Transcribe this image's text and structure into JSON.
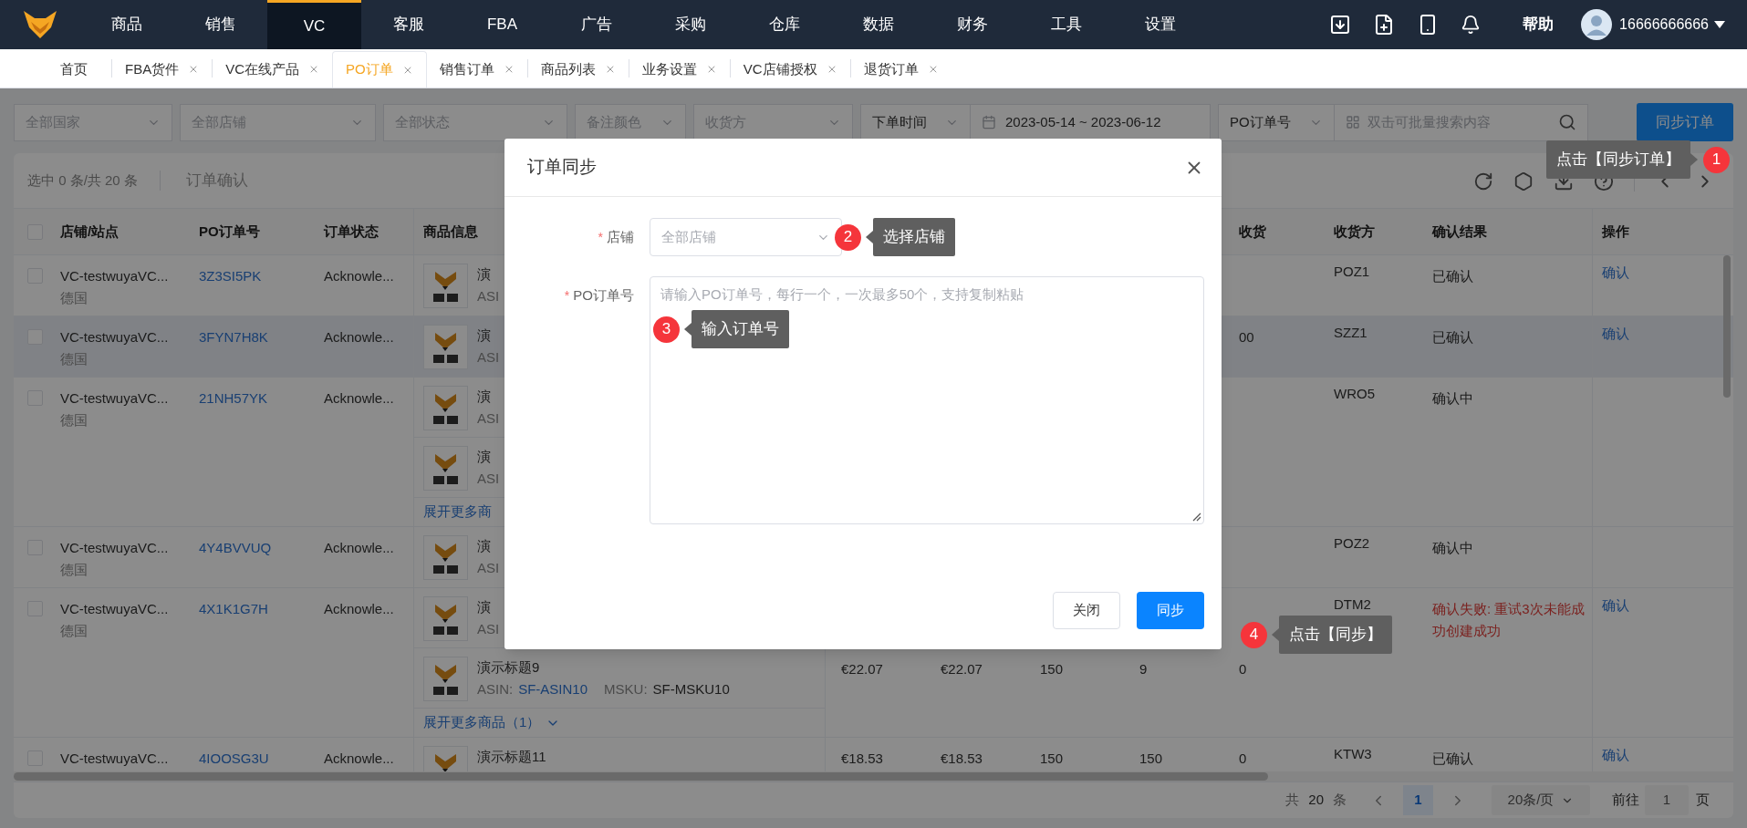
{
  "nav": {
    "items": [
      {
        "label": "商品",
        "selected": false
      },
      {
        "label": "销售",
        "selected": false
      },
      {
        "label": "VC",
        "selected": true
      },
      {
        "label": "客服",
        "selected": false
      },
      {
        "label": "FBA",
        "selected": false
      },
      {
        "label": "广告",
        "selected": false
      },
      {
        "label": "采购",
        "selected": false
      },
      {
        "label": "仓库",
        "selected": false
      },
      {
        "label": "数据",
        "selected": false
      },
      {
        "label": "财务",
        "selected": false
      },
      {
        "label": "工具",
        "selected": false
      },
      {
        "label": "设置",
        "selected": false
      }
    ],
    "help": "帮助",
    "user": "16666666666"
  },
  "tabs": [
    {
      "label": "首页",
      "closable": false,
      "selected": false
    },
    {
      "label": "FBA货件",
      "closable": true,
      "selected": false
    },
    {
      "label": "VC在线产品",
      "closable": true,
      "selected": false
    },
    {
      "label": "PO订单",
      "closable": true,
      "selected": true
    },
    {
      "label": "销售订单",
      "closable": true,
      "selected": false
    },
    {
      "label": "商品列表",
      "closable": true,
      "selected": false
    },
    {
      "label": "业务设置",
      "closable": true,
      "selected": false
    },
    {
      "label": "VC店铺授权",
      "closable": true,
      "selected": false
    },
    {
      "label": "退货订单",
      "closable": true,
      "selected": false
    }
  ],
  "filters": {
    "country": {
      "placeholder": "全部国家"
    },
    "store": {
      "placeholder": "全部店铺"
    },
    "status": {
      "placeholder": "全部状态"
    },
    "note_color": {
      "placeholder": "备注颜色"
    },
    "receiver": {
      "placeholder": "收货方"
    },
    "date_type": "下单时间",
    "date_range": "2023-05-14 ~ 2023-06-12",
    "search_type": "PO订单号",
    "search": {
      "placeholder": "双击可批量搜索内容"
    },
    "sync_button": "同步订单"
  },
  "toolbar": {
    "selection": "选中 0 条/共 20 条",
    "confirm_button": "订单确认"
  },
  "table": {
    "header_checked": false,
    "columns": {
      "store": "店铺/站点",
      "po": "PO订单号",
      "status": "订单状态",
      "product": "商品信息",
      "received": "收货",
      "receiver": "收货方",
      "result": "确认结果",
      "action": "操作"
    },
    "rows": [
      {
        "checked": false,
        "highlighted": false,
        "store": "VC-testwuyaVC...",
        "site": "德国",
        "po": "3Z3SI5PK",
        "status": "Acknowle...",
        "products": [
          {
            "title": "演",
            "asin_label": "ASI"
          }
        ],
        "receiver": "POZ1",
        "result": {
          "text": "已确认",
          "kind": "normal"
        },
        "action": "确认"
      },
      {
        "checked": false,
        "highlighted": true,
        "store": "VC-testwuyaVC...",
        "site": "德国",
        "po": "3FYN7H8K",
        "status": "Acknowle...",
        "products": [
          {
            "title": "演",
            "asin_label": "ASI",
            "values": {
              "received": "00"
            }
          }
        ],
        "receiver": "SZZ1",
        "result": {
          "text": "已确认",
          "kind": "normal"
        },
        "action": "确认"
      },
      {
        "checked": false,
        "highlighted": false,
        "store": "VC-testwuyaVC...",
        "site": "德国",
        "po": "21NH57YK",
        "status": "Acknowle...",
        "products": [
          {
            "title": "演",
            "asin_label": "ASI"
          },
          {
            "title": "演",
            "asin_label": "ASI"
          }
        ],
        "more": {
          "text": "展开更多商",
          "chevron": false
        },
        "receiver": "WRO5",
        "result": {
          "text": "确认中",
          "kind": "normal"
        }
      },
      {
        "checked": false,
        "highlighted": false,
        "store": "VC-testwuyaVC...",
        "site": "德国",
        "po": "4Y4BVVUQ",
        "status": "Acknowle...",
        "products": [
          {
            "title": "演",
            "asin_label": "ASI"
          }
        ],
        "receiver": "POZ2",
        "result": {
          "text": "确认中",
          "kind": "normal"
        }
      },
      {
        "checked": false,
        "highlighted": false,
        "store": "VC-testwuyaVC...",
        "site": "德国",
        "po": "4X1K1G7H",
        "status": "Acknowle...",
        "products": [
          {
            "title": "演",
            "asin_label": "ASI"
          },
          {
            "title": "演示标题9",
            "asin_label": "ASIN:",
            "asin": "SF-ASIN10",
            "msku_label": "MSKU:",
            "msku": "SF-MSKU10",
            "values": {
              "column_5": "€22.07",
              "column_6": "€22.07",
              "column_7": "150",
              "column_8": "9",
              "received": "0"
            }
          }
        ],
        "more": {
          "text": "展开更多商品（1）",
          "chevron": true
        },
        "receiver": "DTM2",
        "result": {
          "text": "确认失败: 重试3次未能成功创建成功",
          "kind": "failed"
        },
        "action": "确认"
      },
      {
        "checked": false,
        "highlighted": false,
        "store": "VC-testwuyaVC...",
        "po": "4IOOSG3U",
        "status": "Acknowle...",
        "products": [
          {
            "title": "演示标题11",
            "values": {
              "column_5": "€18.53",
              "column_6": "€18.53",
              "column_7": "150",
              "column_8": "150",
              "received": "0"
            }
          }
        ],
        "receiver": "KTW3",
        "result": {
          "text": "已确认",
          "kind": "normal"
        },
        "action": "确认"
      }
    ]
  },
  "pagination": {
    "total_prefix": "共",
    "total": "20",
    "total_suffix": "条",
    "pages": [
      {
        "label": "1",
        "selected": true
      }
    ],
    "page_size": "20条/页",
    "goto_label": "前往",
    "goto_value": "1",
    "goto_suffix": "页"
  },
  "modal": {
    "title": "订单同步",
    "required_mark": "*",
    "store_label": "店铺",
    "store_placeholder": "全部店铺",
    "po_label": "PO订单号",
    "po_placeholder": "请输入PO订单号，每行一个，一次最多50个，支持复制粘贴",
    "buttons": [
      {
        "label": "关闭",
        "kind": "default"
      },
      {
        "label": "同步",
        "kind": "primary"
      }
    ]
  },
  "callouts": [
    {
      "number": "1",
      "text": "点击【同步订单】"
    },
    {
      "number": "2",
      "text": "选择店铺"
    },
    {
      "number": "3",
      "text": "输入订单号"
    },
    {
      "number": "4",
      "text": "点击【同步】"
    }
  ]
}
